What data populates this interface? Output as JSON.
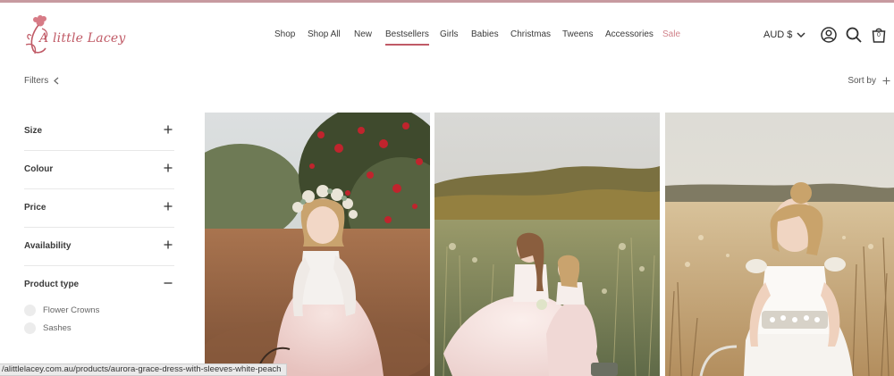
{
  "brand": {
    "name": "A little Lacey",
    "accent": "#c05a66"
  },
  "nav": {
    "items": [
      {
        "label": "Shop"
      },
      {
        "label": "Shop All"
      },
      {
        "label": "New"
      },
      {
        "label": "Bestsellers",
        "active": true
      },
      {
        "label": "Girls"
      },
      {
        "label": "Babies"
      },
      {
        "label": "Christmas"
      },
      {
        "label": "Tweens"
      },
      {
        "label": "Accessories"
      },
      {
        "label": "Sale"
      }
    ]
  },
  "header": {
    "currency": "AUD $",
    "icons": [
      "account-icon",
      "search-icon",
      "cart-icon"
    ],
    "cart_count": "0"
  },
  "toolbar": {
    "filters_label": "Filters",
    "sort_label": "Sort by"
  },
  "sidebar": {
    "facets": [
      {
        "label": "Size",
        "open": false
      },
      {
        "label": "Colour",
        "open": false
      },
      {
        "label": "Price",
        "open": false
      },
      {
        "label": "Availability",
        "open": false
      },
      {
        "label": "Product type",
        "open": true
      }
    ],
    "product_type_options": [
      {
        "label": "Flower Crowns"
      },
      {
        "label": "Sashes"
      }
    ]
  },
  "status_url": "/alittlelacey.com.au/products/aurora-grace-dress-with-sleeves-white-peach"
}
